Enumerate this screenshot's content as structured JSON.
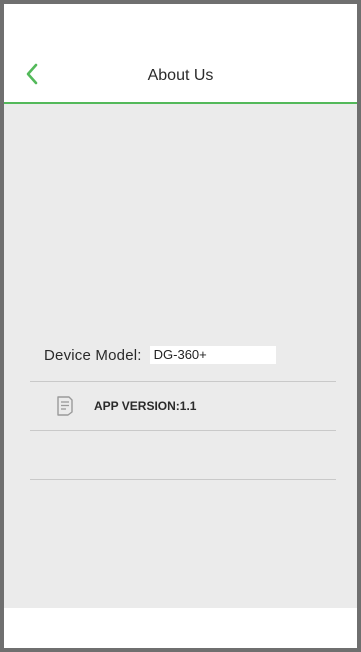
{
  "header": {
    "title": "About Us",
    "back_icon": "chevron-left-icon"
  },
  "colors": {
    "accent": "#53b95a",
    "background": "#ebebeb",
    "frame": "#6f6f6f"
  },
  "about": {
    "device_model_label": "Device Model:",
    "device_model_value": "DG-360+",
    "version_icon": "document-icon",
    "app_version_text": "APP VERSION:1.1"
  }
}
